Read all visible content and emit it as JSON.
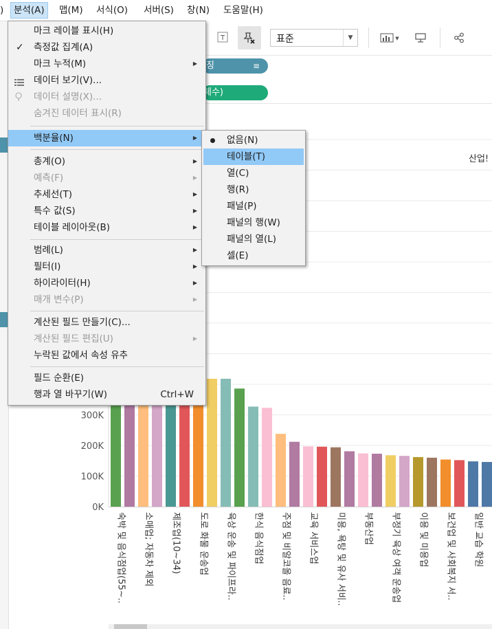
{
  "menubar": {
    "items": [
      {
        "label": "분석(A)",
        "active": true
      },
      {
        "label": "맵(M)"
      },
      {
        "label": "서식(O)"
      },
      {
        "label": "서버(S)"
      },
      {
        "label": "창(N)"
      },
      {
        "label": "도움말(H)"
      }
    ],
    "edge_fragment": ")"
  },
  "toolbar": {
    "fit_value": "표준",
    "icons": [
      "text-label-icon",
      "pin-clear-icon",
      "show-me-icon",
      "presentation-icon",
      "share-icon"
    ]
  },
  "shelves": {
    "rows_pill_text": "징",
    "columns_pill_text": "체수)"
  },
  "analysis_menu": {
    "items": [
      {
        "label": "마크 레이블 표시(H)",
        "type": "item"
      },
      {
        "label": "측정값 집계(A)",
        "type": "item",
        "checked": true
      },
      {
        "label": "마크 누적(M)",
        "type": "submenu"
      },
      {
        "label": "데이터 보기(V)...",
        "type": "item",
        "icon": "table-icon"
      },
      {
        "label": "데이터 설명(X)...",
        "type": "item",
        "disabled": true,
        "icon": "lightbulb-icon"
      },
      {
        "label": "숨겨진 데이터 표시(R)",
        "type": "item",
        "disabled": true
      },
      {
        "label": "백분율(N)",
        "type": "submenu",
        "highlighted": true
      },
      {
        "label": "총계(O)",
        "type": "submenu"
      },
      {
        "label": "예측(F)",
        "type": "submenu",
        "disabled": true
      },
      {
        "label": "추세선(T)",
        "type": "submenu"
      },
      {
        "label": "특수 값(S)",
        "type": "submenu"
      },
      {
        "label": "테이블 레이아웃(B)",
        "type": "submenu"
      },
      {
        "label": "범례(L)",
        "type": "submenu"
      },
      {
        "label": "필터(I)",
        "type": "submenu"
      },
      {
        "label": "하이라이터(H)",
        "type": "submenu"
      },
      {
        "label": "매개 변수(P)",
        "type": "submenu",
        "disabled": true
      },
      {
        "label": "계산된 필드 만들기(C)...",
        "type": "item"
      },
      {
        "label": "계산된 필드 편집(U)",
        "type": "submenu",
        "disabled": true
      },
      {
        "label": "누락된 값에서 속성 유추",
        "type": "item"
      },
      {
        "label": "필드 순환(E)",
        "type": "item"
      },
      {
        "label": "행과 열 바꾸기(W)",
        "type": "item",
        "shortcut": "Ctrl+W"
      }
    ]
  },
  "percent_submenu": {
    "items": [
      {
        "label": "없음(N)",
        "selected": true
      },
      {
        "label": "테이블(T)",
        "highlighted": true
      },
      {
        "label": "열(C)"
      },
      {
        "label": "행(R)"
      },
      {
        "label": "패널(P)"
      },
      {
        "label": "패널의 행(W)"
      },
      {
        "label": "패널의 열(L)"
      },
      {
        "label": "셀(E)"
      }
    ]
  },
  "chart_data": {
    "type": "bar",
    "column_header": "산업!",
    "y_ticks": [
      "0K",
      "100K",
      "200K",
      "300K"
    ],
    "ylim": [
      0,
      470000
    ],
    "visible_ymax": 420000,
    "categories": [
      "숙박 및 음식점업(55~..",
      "",
      "소매업; 자동차 제외",
      "",
      "제조업(10~34)",
      "",
      "도로 화물 운송업",
      "",
      "육상 운송 및 파이프라..",
      "",
      "한식 음식점업",
      "",
      "주점 및 비알코올 음료..",
      "",
      "교육 서비스업",
      "",
      "미용, 욕탕 및 유사 서비..",
      "",
      "부동산업",
      "",
      "부정기 육상 여객 운송업",
      "",
      "이용 및 미용업",
      "",
      "보건업 및 사회복지 서..",
      "",
      "일반 교습 학원"
    ],
    "values": [
      420000,
      420000,
      420000,
      420000,
      420000,
      420000,
      420000,
      418000,
      418000,
      386000,
      327000,
      323000,
      238000,
      212000,
      197000,
      196000,
      194000,
      181000,
      174000,
      173000,
      168000,
      166000,
      162000,
      160000,
      154000,
      152000,
      148000,
      146000
    ],
    "colors": [
      "#59a14f",
      "#b07aa1",
      "#ffbe7d",
      "#d4a6c8",
      "#499894",
      "#e15759",
      "#f28e2b",
      "#f1ce63",
      "#86bcb6",
      "#59a14f",
      "#86bcb6",
      "#fabfd2",
      "#ffbe7d",
      "#b07aa1",
      "#fabfd2",
      "#e15759",
      "#9d7660",
      "#b07aa1",
      "#fabfd2",
      "#b07aa1",
      "#f1ce63",
      "#d4a6c8",
      "#b6992d",
      "#9d7660",
      "#f28e2b",
      "#e15759",
      "#4e79a7",
      "#4e79a7"
    ],
    "grid": true
  }
}
